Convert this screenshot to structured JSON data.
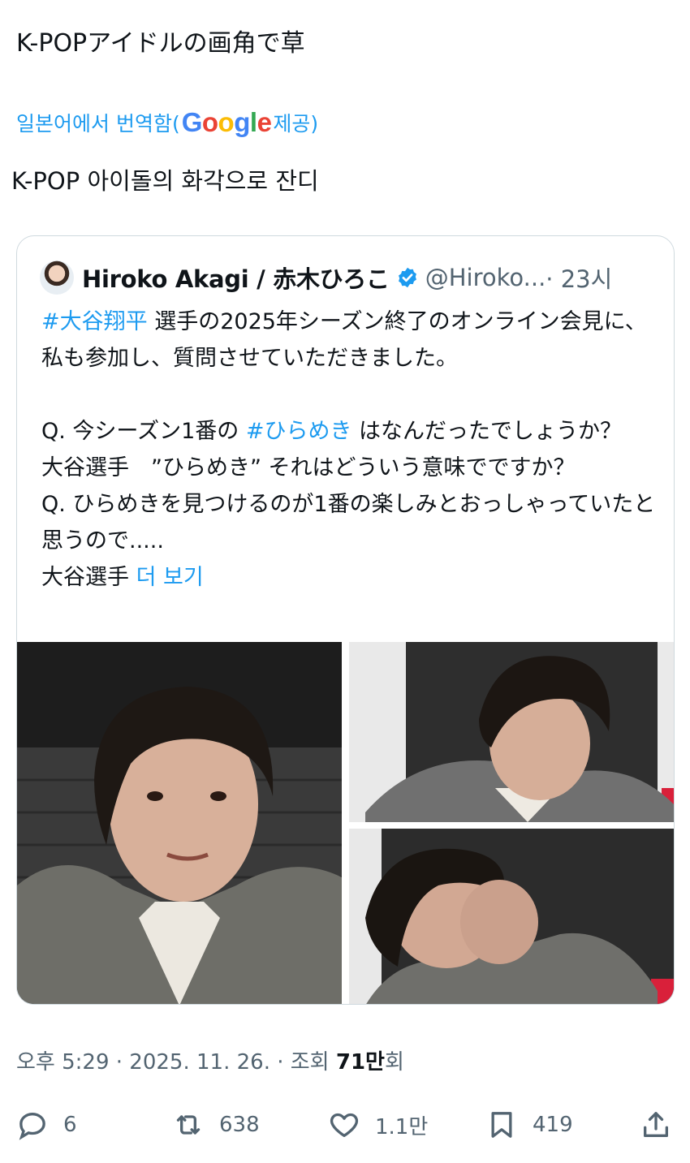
{
  "post": {
    "text": "K-POPアイドルの画角で草",
    "translation": {
      "prefix": "일본어에서 번역함(",
      "google_letters": [
        "G",
        "o",
        "o",
        "g",
        "l",
        "e"
      ],
      "suffix": " 제공)",
      "text": "K-POP 아이돌의 화각으로 잔디"
    }
  },
  "quote": {
    "author_name": "Hiroko Akagi / 赤木ひろこ",
    "handle": "@Hiroko...",
    "time": "· 23시",
    "hashtag1": "#大谷翔平",
    "line1_rest": " 選手の2025年シーズン終了のオンライン会見に、私も参加し、質問させていただきました。",
    "q1_prefix": "Q. 今シーズン1番の ",
    "hashtag2": "#ひらめき",
    "q1_rest": " はなんだったでしょうか？",
    "a1": "大谷選手　”ひらめき” それはどういう意味でですか？",
    "q2": "Q. ひらめきを見つけるのが1番の楽しみとおっしゃっていたと思うので.....",
    "a2": "大谷選手 ",
    "more": "더 보기"
  },
  "meta": {
    "time": "오후 5:29",
    "date": "2025. 11. 26.",
    "views_label_prefix": "조회 ",
    "views_count": "71만",
    "views_label_suffix": "회",
    "separator": " · "
  },
  "actions": {
    "replies": "6",
    "reposts": "638",
    "likes": "1.1만",
    "bookmarks": "419"
  },
  "colors": {
    "link": "#1d9bf0",
    "text": "#0f1419",
    "muted": "#536471",
    "border": "#cfd9de"
  }
}
